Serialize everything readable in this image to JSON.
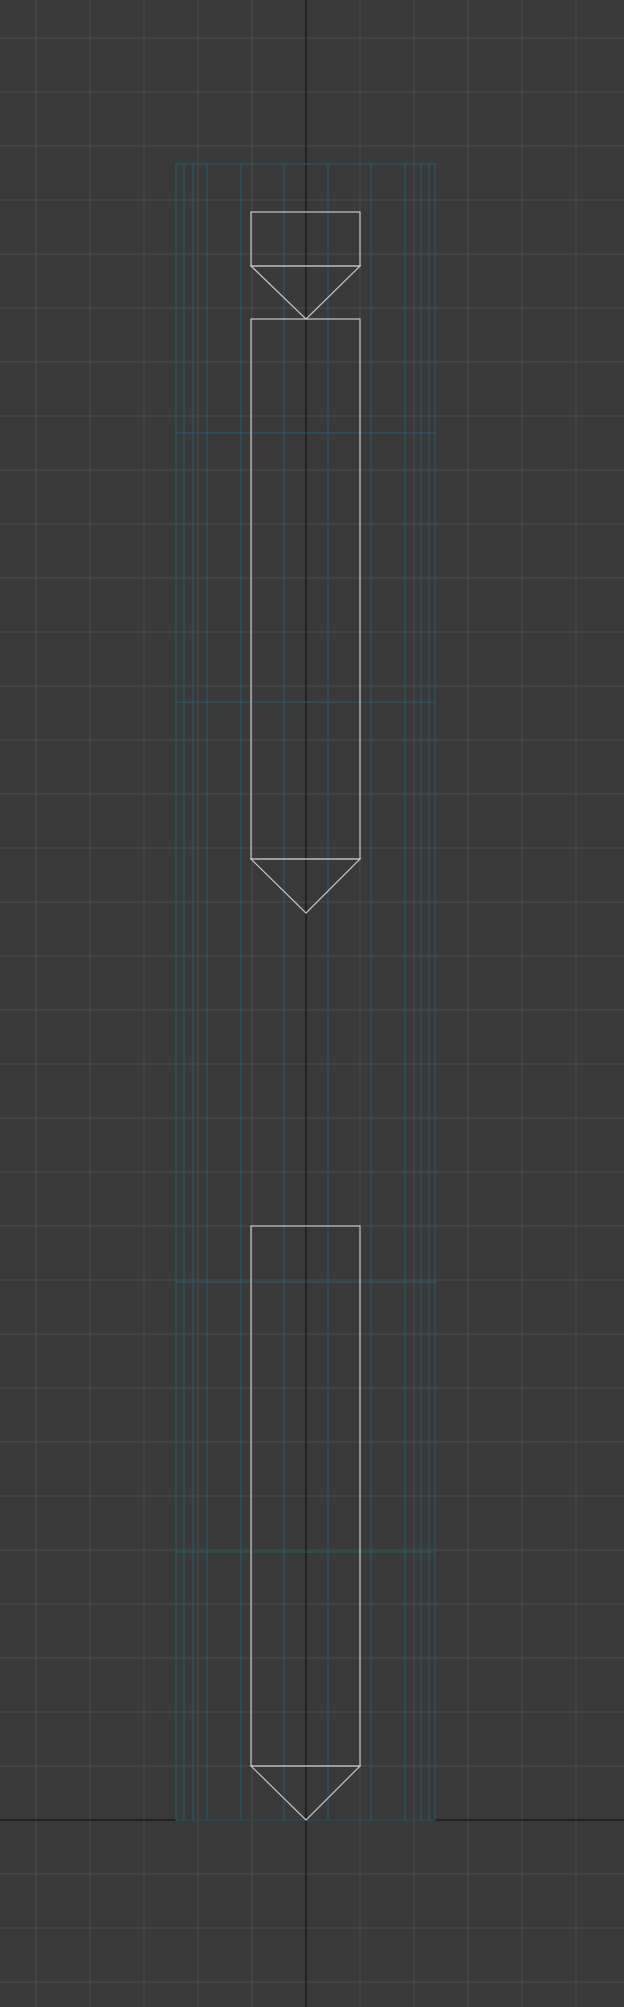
{
  "viewport": {
    "view": "front-orthographic",
    "grid_visible": true,
    "colors": {
      "background": "#393939",
      "grid": "#4a4a4a",
      "axis": "#141414",
      "guide": "#1f5f70",
      "outline": "#c8c8c8"
    }
  },
  "objects": [
    {
      "name": "top-cap",
      "type": "profile-rectangle"
    },
    {
      "name": "tip-connector-top",
      "type": "profile-triangle"
    },
    {
      "name": "upper-body",
      "type": "profile-rectangle"
    },
    {
      "name": "tip-connector-upper",
      "type": "profile-triangle"
    },
    {
      "name": "lower-body",
      "type": "profile-rectangle"
    },
    {
      "name": "pencil-tip",
      "type": "profile-triangle"
    }
  ]
}
